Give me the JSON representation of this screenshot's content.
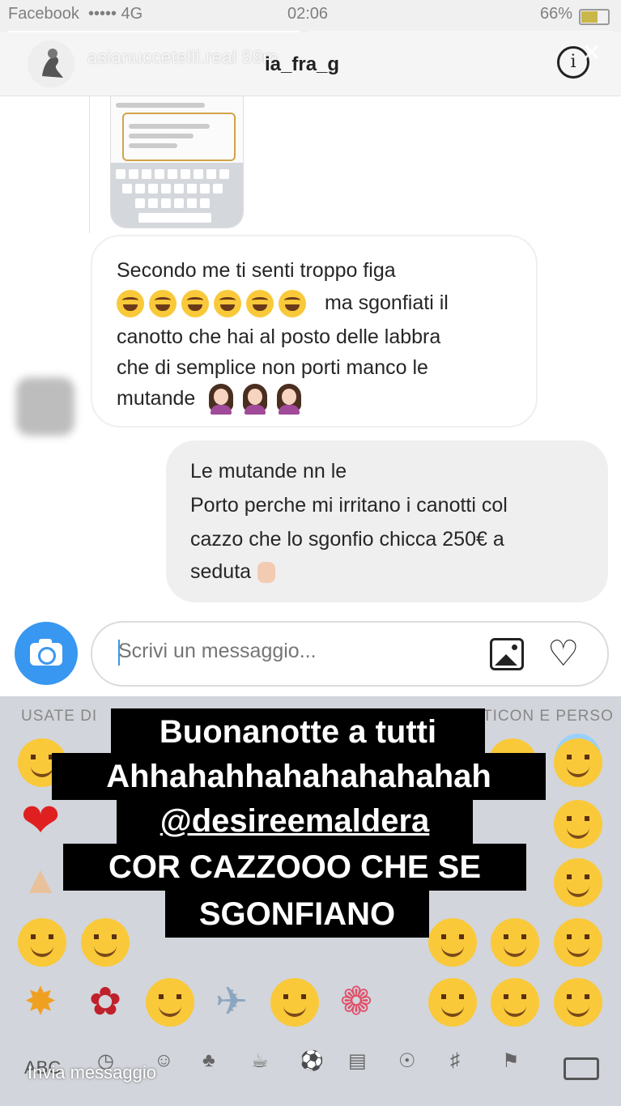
{
  "status_bar": {
    "carrier": "Facebook",
    "network": "4G",
    "time": "02:06",
    "battery": "66%"
  },
  "story": {
    "username": "asianuccetelli.real",
    "age": "59m"
  },
  "chat_header": {
    "username": "ia_fra_g"
  },
  "messages": {
    "received": [
      "Secondo me ti senti troppo figa",
      "ma sgonfiati il",
      "canotto che hai al posto delle labbra",
      "che di semplice non porti manco le",
      "mutande"
    ],
    "sent": [
      "Le mutande nn le",
      "Porto perche mi irritano i canotti col",
      "cazzo che lo sgonfio chicca 250€ a",
      "seduta"
    ]
  },
  "composer": {
    "placeholder": "Scrivi un messaggio..."
  },
  "keyboard": {
    "section_left": "USATE DI",
    "section_right": "TICON E PERSO",
    "abc_label": "ABC",
    "send_hint": "Invia messaggio"
  },
  "caption": {
    "line1": "Buonanotte a tutti",
    "line2": "Ahhahahhahahahahahah",
    "line3": "@desireemaldera",
    "line4": "COR CAZZOOO CHE SE",
    "line5": "SGONFIANO"
  },
  "colors": {
    "accent": "#3897f0",
    "bubble_sent": "#efefef",
    "caption_bg": "#000000"
  },
  "icons": [
    "camera-icon",
    "gallery-icon",
    "heart-icon",
    "info-icon",
    "close-icon",
    "delete-icon"
  ]
}
